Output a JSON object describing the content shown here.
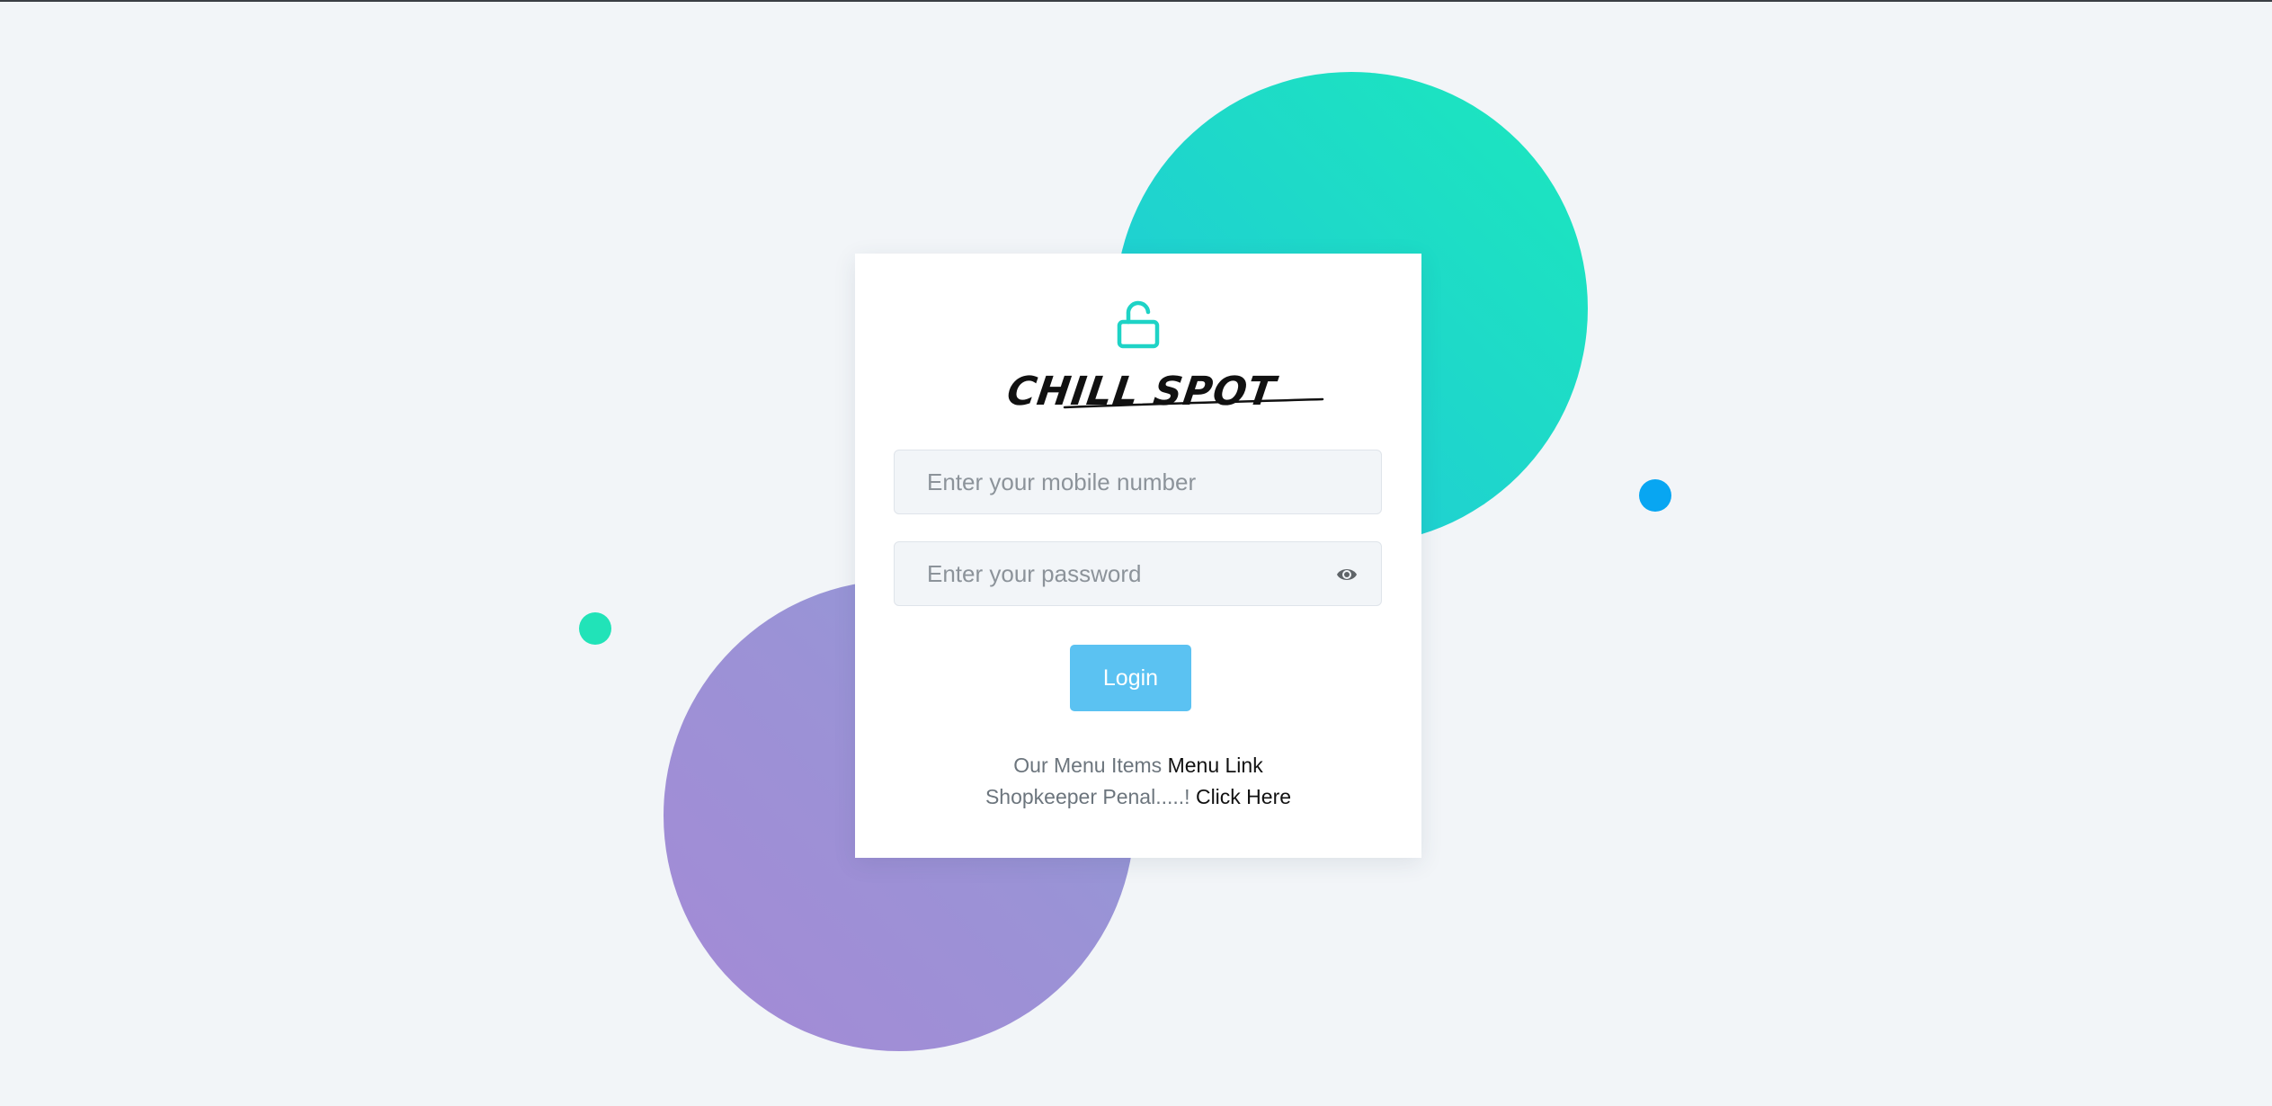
{
  "colors": {
    "background": "#f2f5f8",
    "accent_teal": "#1ed9c9",
    "accent_purple": "#9b92d6",
    "dot_green": "#21e3b8",
    "dot_blue": "#08a6f2",
    "button": "#5bc2f2"
  },
  "header": {
    "icon": "unlock-icon",
    "logo_text": "CHILL SPOT"
  },
  "form": {
    "mobile_placeholder": "Enter your mobile number",
    "mobile_value": "",
    "password_placeholder": "Enter your password",
    "password_value": "",
    "password_toggle_icon": "eye-icon",
    "login_label": "Login"
  },
  "links": {
    "menu_prefix": "Our Menu Items",
    "menu_link": "Menu Link",
    "shop_prefix": "Shopkeeper Penal.....!",
    "shop_link": "Click Here"
  }
}
